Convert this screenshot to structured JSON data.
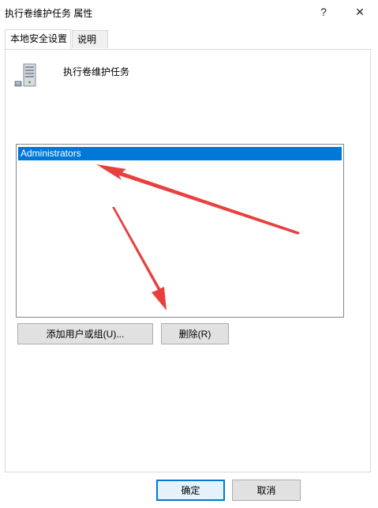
{
  "window": {
    "title": "执行卷维护任务 属性",
    "help_glyph": "?",
    "close_glyph": "✕"
  },
  "tabs": [
    {
      "label": "本地安全设置",
      "active": true
    },
    {
      "label": "说明",
      "active": false
    }
  ],
  "policy": {
    "name": "执行卷维护任务",
    "icon": "server-icon"
  },
  "members": {
    "items": [
      {
        "label": "Administrators",
        "selected": true
      }
    ]
  },
  "buttons": {
    "add": "添加用户或组(U)...",
    "remove": "删除(R)",
    "ok": "确定",
    "cancel": "取消"
  },
  "colors": {
    "accent": "#0078d7",
    "annotation_arrow": "#e8403f"
  }
}
